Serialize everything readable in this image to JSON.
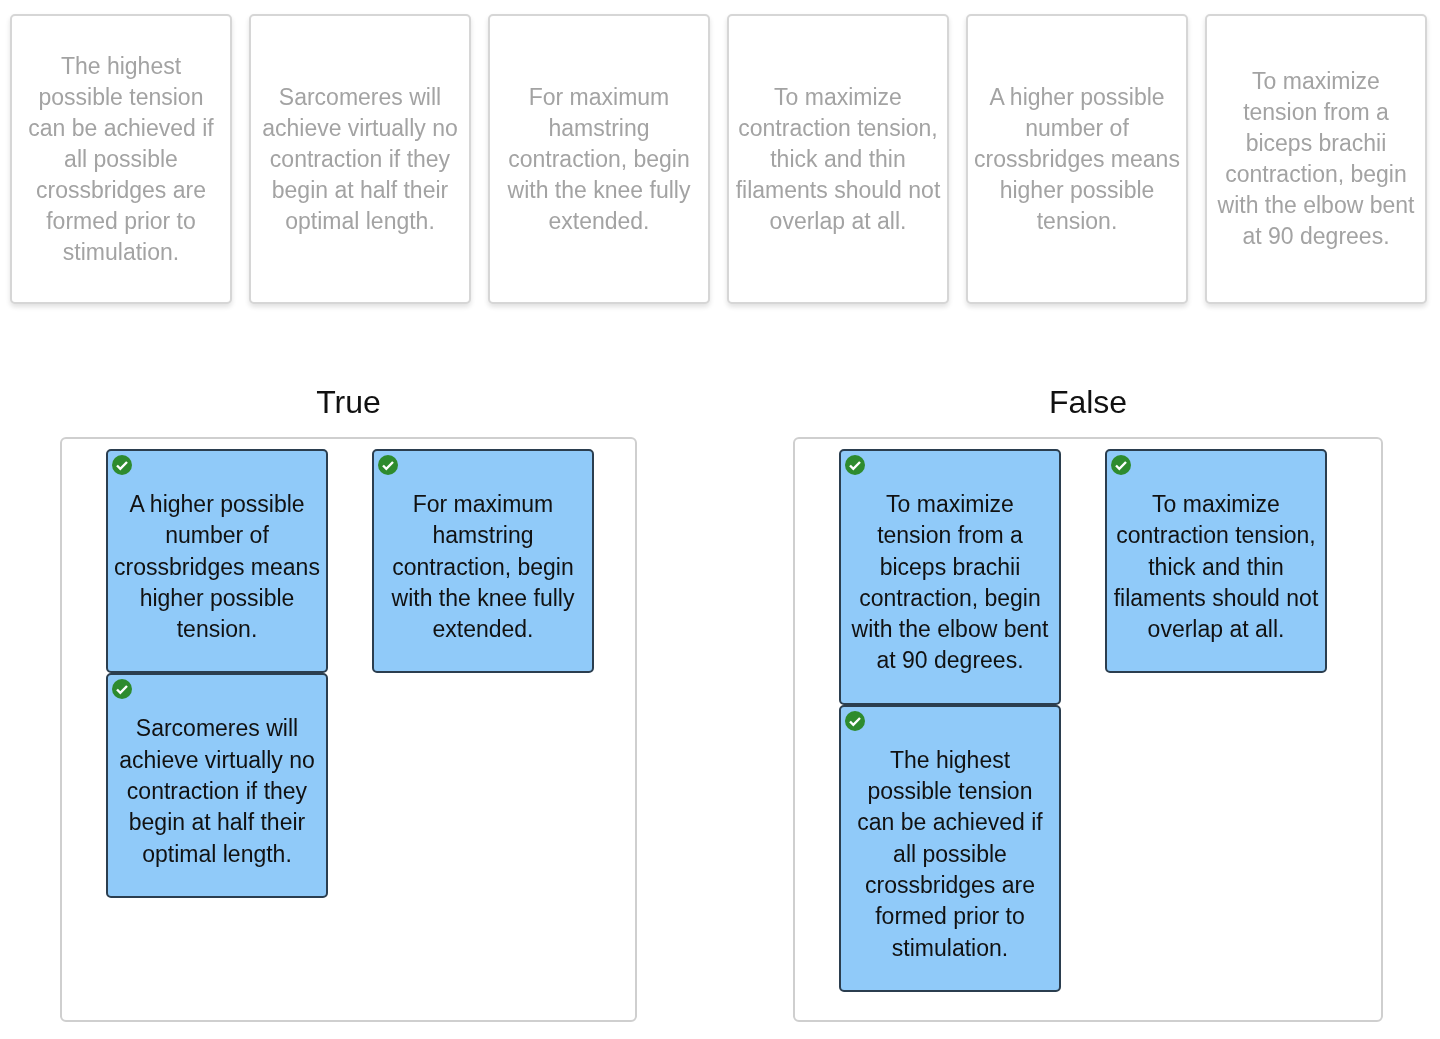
{
  "pool": [
    {
      "text": "The highest possible tension can be achieved if all possible crossbridges are formed prior to stimulation.",
      "placed": true
    },
    {
      "text": "Sarcomeres will achieve virtually no contraction if they begin at half their optimal length.",
      "placed": true
    },
    {
      "text": "For maximum hamstring contraction, begin with the knee fully extended.",
      "placed": true
    },
    {
      "text": "To maximize contraction tension, thick and thin filaments should not overlap at all.",
      "placed": true
    },
    {
      "text": "A higher possible number of crossbridges means higher possible tension.",
      "placed": true
    },
    {
      "text": "To maximize tension from a biceps brachii contraction, begin with the elbow bent at 90 degrees.",
      "placed": true
    }
  ],
  "bins": [
    {
      "title": "True",
      "columns": [
        [
          {
            "text": "A higher possible number of crossbridges means higher possible tension.",
            "correct": true
          },
          {
            "text": "Sarcomeres will achieve virtually no contraction if they begin at half their optimal length.",
            "correct": true
          }
        ],
        [
          {
            "text": "For maximum hamstring contraction, begin with the knee fully extended.",
            "correct": true
          }
        ]
      ]
    },
    {
      "title": "False",
      "columns": [
        [
          {
            "text": "To maximize tension from a biceps brachii contraction, begin with the elbow bent at 90 degrees.",
            "correct": true
          },
          {
            "text": "The highest possible tension can be achieved if all possible crossbridges are formed prior to stimulation.",
            "correct": true
          }
        ],
        [
          {
            "text": "To maximize contraction tension, thick and thin filaments should not overlap at all.",
            "correct": true
          }
        ]
      ]
    }
  ]
}
